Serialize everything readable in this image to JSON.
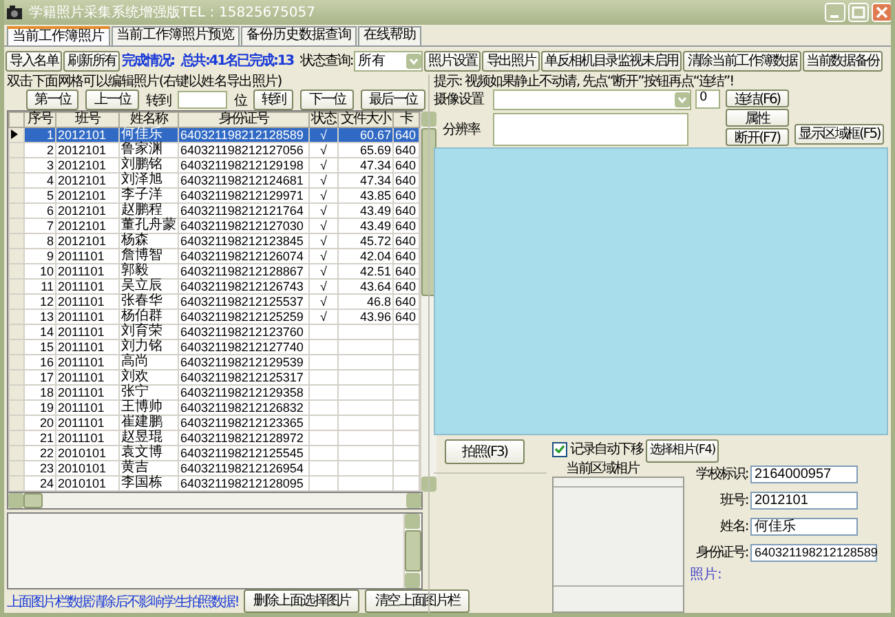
{
  "window": {
    "title": "学籍照片采集系统增强版TEL：15825675057"
  },
  "tabs": [
    {
      "label": "当前工作簿照片",
      "selected": true
    },
    {
      "label": "当前工作簿照片预览",
      "selected": false
    },
    {
      "label": "备份历史数据查询",
      "selected": false
    },
    {
      "label": "在线帮助",
      "selected": false
    }
  ],
  "toolbar": {
    "buttons_left": [
      "导入名单",
      "刷新所有"
    ],
    "progress_label": "完成情况:",
    "progress_value": "总共:41名已完成:13",
    "filter_label": "状态查询:",
    "filter_value": "所有",
    "buttons_right": [
      "照片设置",
      "导出照片",
      "单反相机目录监视未启用",
      "清除当前工作簿数据",
      "当前数据备份"
    ]
  },
  "roster": {
    "caption": "双击下面网格可以编辑照片(右键以姓名导出照片)",
    "nav": [
      {
        "kind": "button",
        "label": "第一位"
      },
      {
        "kind": "button",
        "label": "上一位"
      },
      {
        "kind": "label",
        "label": "转到"
      },
      {
        "kind": "field"
      },
      {
        "kind": "label",
        "label": "位"
      },
      {
        "kind": "button",
        "label": "转到"
      },
      {
        "kind": "button",
        "label": "下一位"
      },
      {
        "kind": "button",
        "label": "最后一位"
      }
    ],
    "columns": [
      "序号",
      "班号",
      "姓名称",
      "身份证号",
      "状态",
      "文件大小",
      "卡"
    ],
    "rows": [
      {
        "no": "1",
        "class": "2012101",
        "name": "何佳乐",
        "id": "640321198212128589",
        "status": "√",
        "size": "60.67",
        "col_7": "640",
        "selected": true
      },
      {
        "no": "2",
        "class": "2012101",
        "name": "鲁家渊",
        "id": "640321198212127056",
        "status": "√",
        "size": "65.69",
        "col_7": "640",
        "selected": false
      },
      {
        "no": "3",
        "class": "2012101",
        "name": "刘鹏铭",
        "id": "640321198212129198",
        "status": "√",
        "size": "47.34",
        "col_7": "640",
        "selected": false
      },
      {
        "no": "4",
        "class": "2012101",
        "name": "刘泽旭",
        "id": "640321198212124681",
        "status": "√",
        "size": "47.34",
        "col_7": "640",
        "selected": false
      },
      {
        "no": "5",
        "class": "2012101",
        "name": "李子洋",
        "id": "640321198212129971",
        "status": "√",
        "size": "43.85",
        "col_7": "640",
        "selected": false
      },
      {
        "no": "6",
        "class": "2012101",
        "name": "赵鹏程",
        "id": "640321198212121764",
        "status": "√",
        "size": "43.49",
        "col_7": "640",
        "selected": false
      },
      {
        "no": "7",
        "class": "2012101",
        "name": "董孔舟蒙",
        "id": "640321198212127030",
        "status": "√",
        "size": "43.49",
        "col_7": "640",
        "selected": false
      },
      {
        "no": "8",
        "class": "2012101",
        "name": "杨森",
        "id": "640321198212123845",
        "status": "√",
        "size": "45.72",
        "col_7": "640",
        "selected": false
      },
      {
        "no": "9",
        "class": "2011101",
        "name": "詹博智",
        "id": "640321198212126074",
        "status": "√",
        "size": "42.04",
        "col_7": "640",
        "selected": false
      },
      {
        "no": "10",
        "class": "2011101",
        "name": "郭毅",
        "id": "640321198212128867",
        "status": "√",
        "size": "42.51",
        "col_7": "640",
        "selected": false
      },
      {
        "no": "11",
        "class": "2011101",
        "name": "吴立辰",
        "id": "640321198212126743",
        "status": "√",
        "size": "43.64",
        "col_7": "640",
        "selected": false
      },
      {
        "no": "12",
        "class": "2011101",
        "name": "张春华",
        "id": "640321198212125537",
        "status": "√",
        "size": "46.8",
        "col_7": "640",
        "selected": false
      },
      {
        "no": "13",
        "class": "2011101",
        "name": "杨伯群",
        "id": "640321198212125259",
        "status": "√",
        "size": "43.96",
        "col_7": "640",
        "selected": false
      },
      {
        "no": "14",
        "class": "2011101",
        "name": "刘育荣",
        "id": "640321198212123760",
        "selected": false
      },
      {
        "no": "15",
        "class": "2011101",
        "name": "刘力铭",
        "id": "640321198212127740",
        "selected": false
      },
      {
        "no": "16",
        "class": "2011101",
        "name": "高尚",
        "id": "640321198212129539",
        "selected": false
      },
      {
        "no": "17",
        "class": "2011101",
        "name": "刘欢",
        "id": "640321198212125317",
        "selected": false
      },
      {
        "no": "18",
        "class": "2011101",
        "name": "张宁",
        "id": "640321198212129358",
        "selected": false
      },
      {
        "no": "19",
        "class": "2011101",
        "name": "王博帅",
        "id": "640321198212126832",
        "selected": false
      },
      {
        "no": "20",
        "class": "2011101",
        "name": "崔建鹏",
        "id": "640321198212123365",
        "selected": false
      },
      {
        "no": "21",
        "class": "2011101",
        "name": "赵昱琨",
        "id": "640321198212128972",
        "selected": false
      },
      {
        "no": "22",
        "class": "2010101",
        "name": "袁文博",
        "id": "640321198212125545",
        "selected": false
      },
      {
        "no": "23",
        "class": "2010101",
        "name": "黄吉",
        "id": "640321198212126954",
        "selected": false
      },
      {
        "no": "24",
        "class": "2010101",
        "name": "李国栋",
        "id": "640321198212128095",
        "selected": false
      }
    ],
    "note": "上面图片栏数据清除后不影响学生拍照数据!",
    "bottom_buttons": [
      "删除上面选择图片",
      "清空上面图片栏"
    ]
  },
  "camera": {
    "hint": "提示: 视频如果静止不动请, 先点“断开”按钮再点“连结”!",
    "device_label": "摄像设置",
    "device_index": "0",
    "resolution_label": "分辨率",
    "connect_button": "连结(F6)",
    "properties_button": "属性",
    "disconnect_button": "断开(F7)",
    "frame_button": "显示区域框(F5)"
  },
  "capture": {
    "shoot_button": "拍照(F3)",
    "auto_next": {
      "label": "记录自动下移",
      "checked": true
    },
    "region_label": "当前区域相片",
    "choose_button": "选择相片(F4)",
    "fields": [
      {
        "label": "学校标识:",
        "value": "2164000957"
      },
      {
        "label": "班号:",
        "value": "2012101"
      },
      {
        "label": "姓名:",
        "value": "何佳乐"
      },
      {
        "label": "身份证号:",
        "value": "640321198212128589"
      }
    ],
    "photo_info": "照片:"
  }
}
